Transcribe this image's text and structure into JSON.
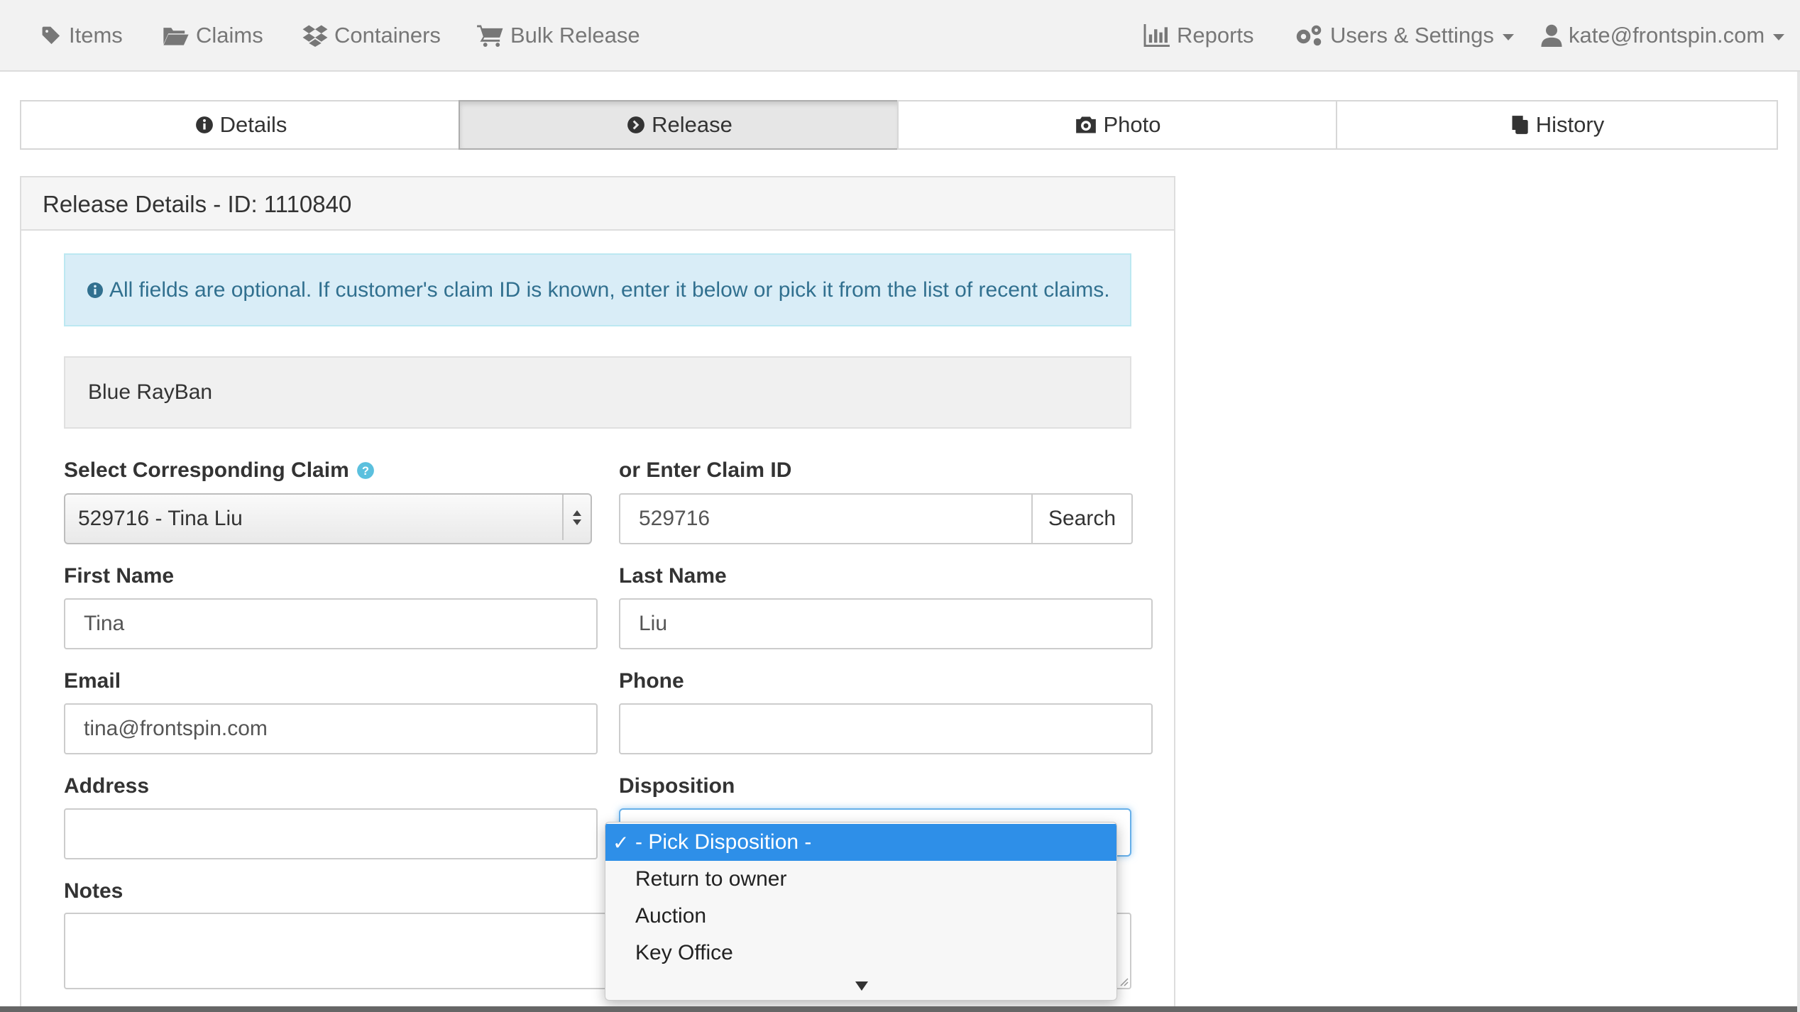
{
  "nav": {
    "items": "Items",
    "claims": "Claims",
    "containers": "Containers",
    "bulk_release": "Bulk Release",
    "reports": "Reports",
    "users_settings": "Users & Settings",
    "account": "kate@frontspin.com"
  },
  "tabs": {
    "details": "Details",
    "release": "Release",
    "photo": "Photo",
    "history": "History"
  },
  "panel": {
    "title": "Release Details - ID: 1110840"
  },
  "alert": {
    "text": "All fields are optional. If customer's claim ID is known, enter it below or pick it from the list of recent claims."
  },
  "item_name": "Blue RayBan",
  "form": {
    "claim_select_label": "Select Corresponding Claim",
    "claim_select_value": "529716 - Tina Liu",
    "claim_id_label": "or Enter Claim ID",
    "claim_id_value": "529716",
    "search_button": "Search",
    "first_name_label": "First Name",
    "first_name_value": "Tina",
    "last_name_label": "Last Name",
    "last_name_value": "Liu",
    "email_label": "Email",
    "email_value": "tina@frontspin.com",
    "phone_label": "Phone",
    "phone_value": "",
    "address_label": "Address",
    "address_value": "",
    "disposition_label": "Disposition",
    "notes_label": "Notes"
  },
  "disposition_options": [
    {
      "label": "- Pick Disposition -",
      "selected": true
    },
    {
      "label": "Return to owner",
      "selected": false
    },
    {
      "label": "Auction",
      "selected": false
    },
    {
      "label": "Key Office",
      "selected": false
    }
  ],
  "colors": {
    "accent": "#2e8fe8",
    "alert_bg": "#d9edf7",
    "alert_text": "#31708f",
    "help_icon": "#5bc0de"
  }
}
